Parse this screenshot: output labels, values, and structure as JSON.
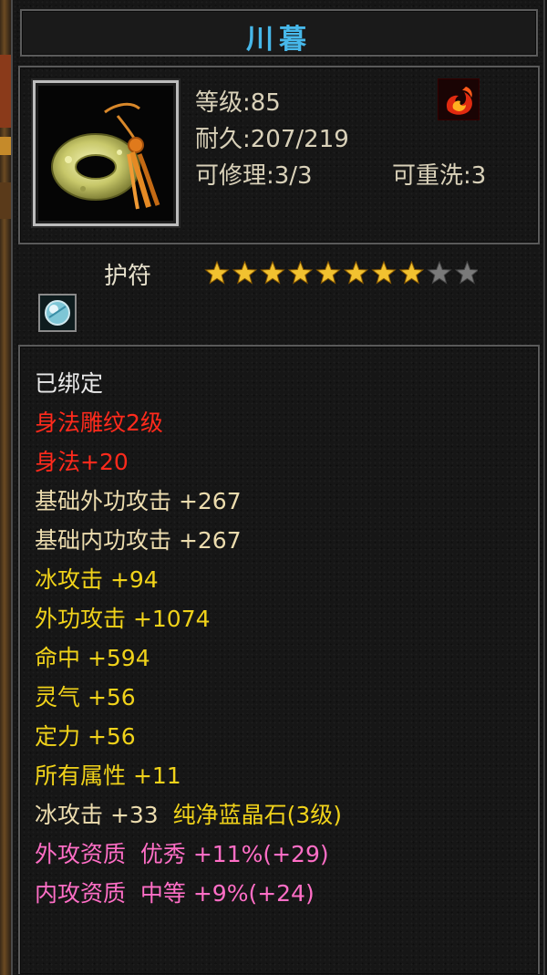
{
  "item": {
    "name": "川暮",
    "level_text": "等级:85",
    "durability_text": "耐久:207/219",
    "repair_text": "可修理:3/3",
    "rewash_text": "可重洗:3",
    "type_label": "护符",
    "stars_filled": 8,
    "stars_total": 10,
    "icon": "jade-ring-amulet-icon",
    "element_icon": "fire-element-icon",
    "socket_icon": "blue-crystal-gem-icon"
  },
  "attributes": {
    "bound": "已绑定",
    "engrave": "身法雕纹2级",
    "agility": "身法+20",
    "base_ext_atk": "基础外功攻击 +267",
    "base_int_atk": "基础内功攻击 +267",
    "ice_atk": "冰攻击 +94",
    "ext_atk": "外功攻击 +1074",
    "hit": "命中 +594",
    "spirit": "灵气 +56",
    "focus": "定力 +56",
    "all_attr": "所有属性 +11",
    "gem_stat": "冰攻击 +33",
    "gem_name": "纯净蓝晶石(3级)",
    "ext_quality": "外攻资质  优秀 +11%(+29)",
    "int_quality": "内攻资质  中等 +9%(+24)"
  },
  "colors": {
    "title": "#47b8ea",
    "bound": "#e9e9e9",
    "red": "#ff2a1c",
    "base": "#ecdcae",
    "bonus": "#f0d21a",
    "quality": "#ff6ec6",
    "star_on": "#f2c230",
    "star_off": "#7a7a7a"
  }
}
